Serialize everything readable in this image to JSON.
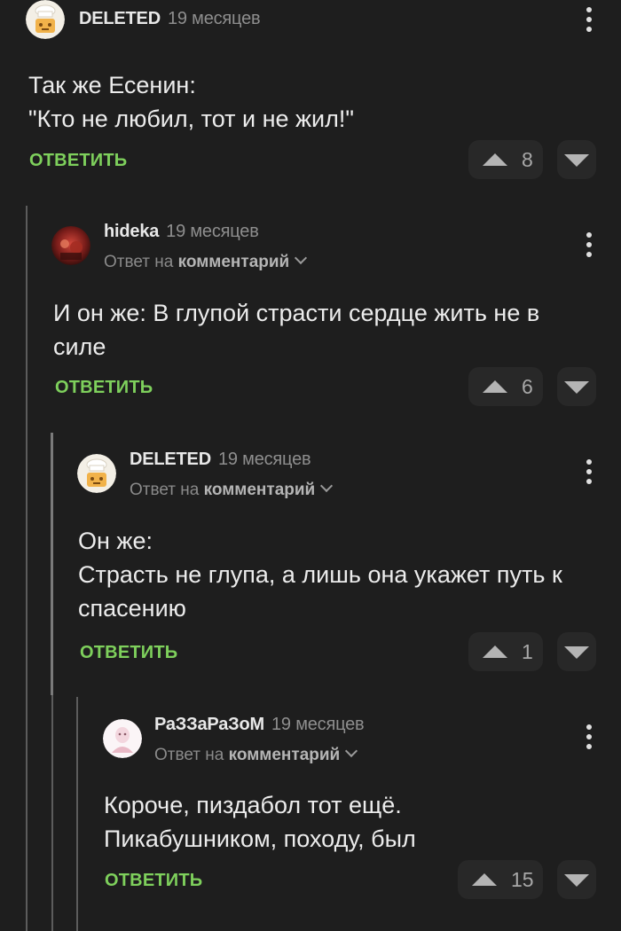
{
  "comments": [
    {
      "author": "DELETED",
      "time": "19 месяцев",
      "reply_prefix": "",
      "reply_target": "",
      "lines": [
        "Так же Есенин:",
        "\"Кто не любил, тот и не жил!\""
      ],
      "reply_label": "ОТВЕТИТЬ",
      "votes": "8",
      "avatar": "chef-avatar"
    },
    {
      "author": "hideka",
      "time": "19 месяцев",
      "reply_prefix": "Ответ на",
      "reply_target": "комментарий",
      "lines": [
        "И он же: В глупой страсти сердце жить не в",
        "силе"
      ],
      "reply_label": "ОТВЕТИТЬ",
      "votes": "6",
      "avatar": "photo-avatar"
    },
    {
      "author": "DELETED",
      "time": "19 месяцев",
      "reply_prefix": "Ответ на",
      "reply_target": "комментарий",
      "lines": [
        "Он же:",
        "Страсть не глупа, а лишь она укажет путь к",
        "спасению"
      ],
      "reply_label": "ОТВЕТИТЬ",
      "votes": "1",
      "avatar": "chef-avatar"
    },
    {
      "author": "РаЗЗаРаЗоМ",
      "time": "19 месяцев",
      "reply_prefix": "Ответ на",
      "reply_target": "комментарий",
      "lines": [
        "Короче, пиздабол тот ещё.",
        "Пикабушником, походу, был"
      ],
      "reply_label": "ОТВЕТИТЬ",
      "votes": "15",
      "avatar": "pink-avatar"
    }
  ],
  "colors": {
    "background": "#1e1e1e",
    "accent_green": "#7ed05c",
    "muted_text": "#8e8e8e"
  }
}
